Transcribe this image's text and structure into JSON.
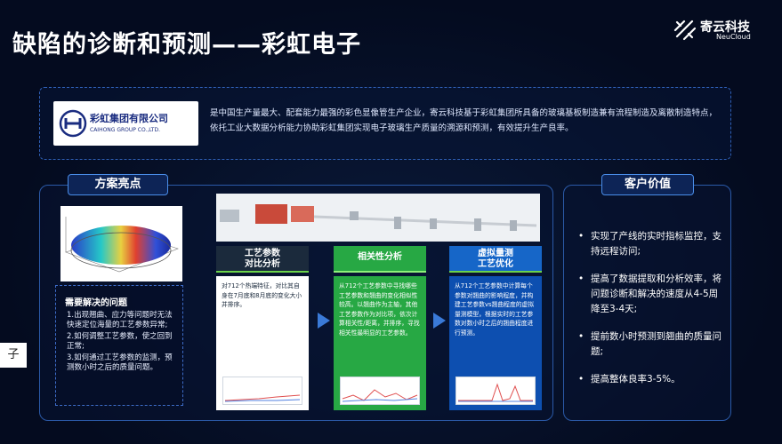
{
  "title": "缺陷的诊断和预测——彩虹电子",
  "brand": {
    "name_cn": "寄云科技",
    "name_en": "NeuCloud"
  },
  "company": {
    "name_cn": "彩虹集团有限公司",
    "name_en": "CAIHONG GROUP CO.,LTD."
  },
  "intro": "是中国生产量最大、配套能力最强的彩色显像管生产企业，寄云科技基于彩虹集团所具备的玻璃基板制造兼有流程制造及离散制造特点，依托工业大数据分析能力协助彩虹集团实现电子玻璃生产质量的溯源和预测，有效提升生产良率。",
  "highlights": {
    "label": "方案亮点",
    "problems": {
      "title": "需要解决的问题",
      "items": [
        "1.出现翘曲、应力等问题时无法快速定位海量的工艺参数异常;",
        "2.如何调整工艺参数，使之回到正常;",
        "3.如何通过工艺参数的监测，预测数小时之后的质量问题。"
      ]
    },
    "steps": [
      {
        "head_line1": "工艺参数",
        "head_line2": "对比分析",
        "text": "对712个热端特征，对比其自身在7月底和8月底的变化大小并排序。"
      },
      {
        "head_line1": "相关性分析",
        "head_line2": "",
        "text": "从712个工艺参数中寻找哪些工艺参数和翘曲的变化相似性较高。以翘曲作为主轴，其他工艺参数作为对比项，依次计算相关性/距离，并排序，寻找相关性最明显的工艺参数。"
      },
      {
        "head_line1": "虚拟量测",
        "head_line2": "工艺优化",
        "text": "从712个工艺参数中计算每个参数对翘曲的影响程度，并构建工艺参数vs翘曲程度的虚拟量测模型，根据实时的工艺参数对数小时之后的翘曲程度进行预测。"
      }
    ]
  },
  "customer_value": {
    "label": "客户价值",
    "items": [
      "实现了产线的实时指标监控，支持远程访问;",
      "提高了数据提取和分析效率，将问题诊断和解决的速度从4-5周降至3-4天;",
      "提前数小时预测到翘曲的质量问题;",
      "提高整体良率3-5%。"
    ]
  },
  "side_fragment": "子",
  "colors": {
    "background": "#040b1f",
    "border": "#2b5aa8",
    "green": "#27a844",
    "blue": "#0d4fb0"
  }
}
